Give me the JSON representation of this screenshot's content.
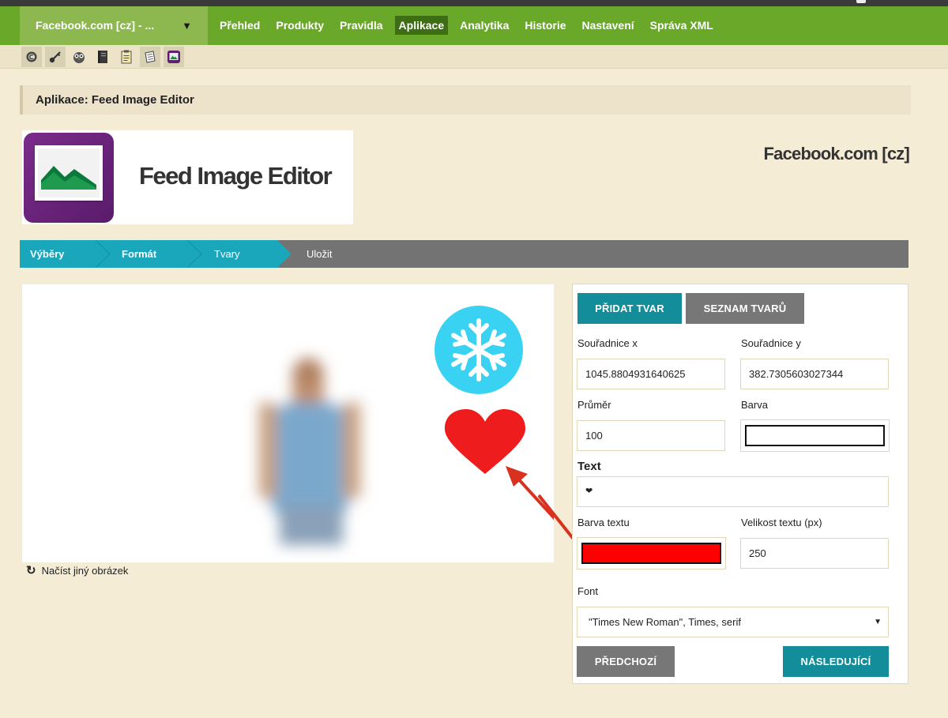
{
  "nav": {
    "shop_select": "Facebook.com [cz] - ...",
    "items": [
      "Přehled",
      "Produkty",
      "Pravidla",
      "Aplikace",
      "Analytika",
      "Historie",
      "Nastavení",
      "Správa XML"
    ],
    "active_index": 3
  },
  "toolbar": {
    "icons": [
      "copyright-icon",
      "key-icon",
      "owl-icon",
      "book-icon",
      "clipboard-icon",
      "note-icon",
      "image-editor-icon"
    ]
  },
  "page": {
    "title": "Aplikace: Feed Image Editor",
    "app_name": "Feed Image Editor",
    "shop_name": "Facebook.com [cz]"
  },
  "wizard": {
    "steps": [
      "Výběry",
      "Formát",
      "Tvary",
      "Uložit"
    ]
  },
  "editor": {
    "reload_label": "Načíst jiný obrázek",
    "heart_text": "❤"
  },
  "form": {
    "add_shape": "PŘIDAT TVAR",
    "shape_list": "SEZNAM TVARŮ",
    "x_label": "Souřadnice x",
    "x_value": "1045.8804931640625",
    "y_label": "Souřadnice y",
    "y_value": "382.7305603027344",
    "diameter_label": "Průměr",
    "diameter_value": "100",
    "color_label": "Barva",
    "color_value": "#ffffff",
    "text_label": "Text",
    "text_value": "❤",
    "text_color_label": "Barva textu",
    "text_color_value": "#ff0000",
    "text_size_label": "Velikost textu (px)",
    "text_size_value": "250",
    "font_label": "Font",
    "font_value": "\"Times New Roman\", Times, serif",
    "prev": "PŘEDCHOZÍ",
    "next": "NÁSLEDUJÍCÍ"
  },
  "colors": {
    "nav_green": "#6aa82a",
    "teal": "#138d9a",
    "snowflake_circle": "#3ad2f2",
    "heart": "#ee1c1c",
    "arrow": "#d9311f"
  }
}
